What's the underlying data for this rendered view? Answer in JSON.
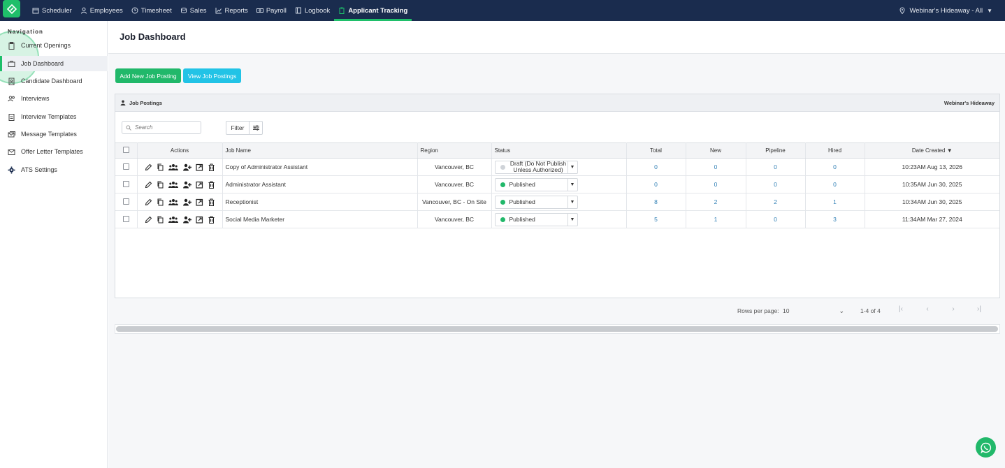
{
  "topbar": {
    "items": [
      {
        "label": "Scheduler",
        "icon": "calendar-icon"
      },
      {
        "label": "Employees",
        "icon": "user-icon"
      },
      {
        "label": "Timesheet",
        "icon": "clock-icon"
      },
      {
        "label": "Sales",
        "icon": "coins-icon"
      },
      {
        "label": "Reports",
        "icon": "chart-line-icon"
      },
      {
        "label": "Payroll",
        "icon": "money-icon"
      },
      {
        "label": "Logbook",
        "icon": "book-icon"
      },
      {
        "label": "Applicant Tracking",
        "icon": "clipboard-icon"
      }
    ],
    "location": "Webinar's Hideaway - All"
  },
  "sidebar": {
    "heading": "Navigation",
    "items": [
      {
        "label": "Current Openings",
        "icon": "clipboard-icon"
      },
      {
        "label": "Job Dashboard",
        "icon": "briefcase-icon"
      },
      {
        "label": "Candidate Dashboard",
        "icon": "id-badge-icon"
      },
      {
        "label": "Interviews",
        "icon": "users-icon"
      },
      {
        "label": "Interview Templates",
        "icon": "clipboard-list-icon"
      },
      {
        "label": "Message Templates",
        "icon": "envelopes-icon"
      },
      {
        "label": "Offer Letter Templates",
        "icon": "letter-icon"
      },
      {
        "label": "ATS Settings",
        "icon": "gear-icon"
      }
    ]
  },
  "page": {
    "title": "Job Dashboard",
    "add_button": "Add New Job Posting",
    "view_button": "View Job Postings"
  },
  "panel": {
    "title": "Job Postings",
    "location": "Webinar's Hideaway",
    "search_placeholder": "Search",
    "filter_label": "Filter"
  },
  "table": {
    "headers": {
      "actions": "Actions",
      "job_name": "Job Name",
      "region": "Region",
      "status": "Status",
      "total": "Total",
      "new": "New",
      "pipeline": "Pipeline",
      "hired": "Hired",
      "date_created": "Date Created"
    },
    "rows": [
      {
        "job_name": "Copy of Administrator Assistant",
        "region": "Vancouver, BC",
        "status": "Draft (Do Not Publish Unless Authorized)",
        "total": "0",
        "new": "0",
        "pipeline": "0",
        "hired": "0",
        "date": "10:23AM Aug 13, 2026"
      },
      {
        "job_name": "Administrator Assistant",
        "region": "Vancouver, BC",
        "status": "Published",
        "total": "0",
        "new": "0",
        "pipeline": "0",
        "hired": "0",
        "date": "10:35AM Jun 30, 2025"
      },
      {
        "job_name": "Receptionist",
        "region": "Vancouver, BC - On Site",
        "status": "Published",
        "total": "8",
        "new": "2",
        "pipeline": "2",
        "hired": "1",
        "date": "10:34AM Jun 30, 2025"
      },
      {
        "job_name": "Social Media Marketer",
        "region": "Vancouver, BC",
        "status": "Published",
        "total": "5",
        "new": "1",
        "pipeline": "0",
        "hired": "3",
        "date": "11:34AM Mar 27, 2024"
      }
    ]
  },
  "pager": {
    "rows_label": "Rows per page:",
    "rows_value": "10",
    "range": "1-4 of 4"
  },
  "colors": {
    "topbar": "#1a2c4e",
    "accent": "#21b86a",
    "cyan": "#22c3e6",
    "link": "#2f7fb5",
    "draft_dot": "#cfd3d8",
    "published_dot": "#21b86a"
  }
}
